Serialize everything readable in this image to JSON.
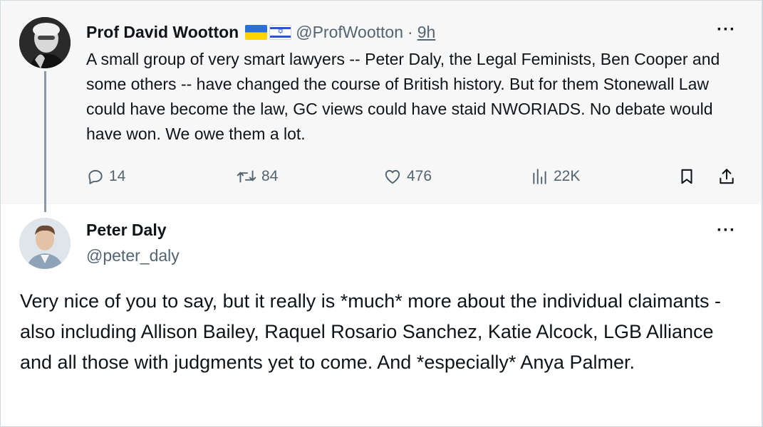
{
  "parent_tweet": {
    "display_name": "Prof David Wootton",
    "handle": "@ProfWootton",
    "separator": "·",
    "time": "9h",
    "text": "A small group of very smart lawyers -- Peter Daly, the Legal Feminists, Ben Cooper and some others -- have changed the course of British history. But for them Stonewall Law could have become the law, GC views could have staid NWORIADS. No debate would have won. We owe them a lot.",
    "more_label": "···",
    "stats": {
      "replies": "14",
      "retweets": "84",
      "likes": "476",
      "views": "22K"
    }
  },
  "reply_tweet": {
    "display_name": "Peter Daly",
    "handle": "@peter_daly",
    "more_label": "···",
    "text": "Very nice of you to say, but it really is *much* more about the individual claimants - also including Allison Bailey, Raquel Rosario Sanchez, Katie Alcock, LGB Alliance and all those with judgments yet to come. And *especially* Anya Palmer."
  },
  "icons": {
    "reply": "reply-icon",
    "retweet": "retweet-icon",
    "like": "heart-icon",
    "views": "views-icon",
    "bookmark": "bookmark-icon",
    "share": "share-icon",
    "flags": [
      "ukraine-flag-icon",
      "israel-flag-icon"
    ]
  },
  "colors": {
    "text_primary": "#0f1419",
    "text_secondary": "#536471",
    "parent_background": "#f7f7f7",
    "thread_line": "#8b98a5"
  }
}
